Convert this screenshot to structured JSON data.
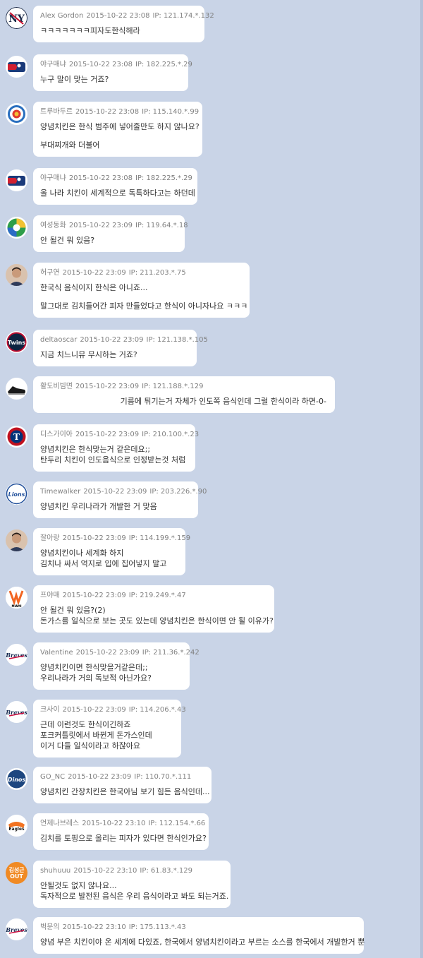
{
  "comments": [
    {
      "nick": "Alex Gordon",
      "time": "2015-10-22 23:08",
      "ip": "IP: 121.174.*.132",
      "lines": [
        "ㅋㅋㅋㅋㅋㅋㅋ피자도한식해라"
      ],
      "avatar_icon": "yankees-logo-icon"
    },
    {
      "nick": "야구매냐",
      "time": "2015-10-22 23:08",
      "ip": "IP: 182.225.*.29",
      "lines": [
        "누구 말이 맞는 거죠?"
      ],
      "avatar_icon": "mlb-logo-icon"
    },
    {
      "nick": "트루바두르",
      "time": "2015-10-22 23:08",
      "ip": "IP: 115.140.*.99",
      "lines": [
        "양념치킨은 한식 범주에 넣어줄만도 하지 않나요?",
        "",
        "부대찌개와 더불어"
      ],
      "avatar_icon": "baseball-classic-logo-icon"
    },
    {
      "nick": "야구매냐",
      "time": "2015-10-22 23:08",
      "ip": "IP: 182.225.*.29",
      "lines": [
        "올 나라 치킨이 세계적으로 독특하다고는 하던데"
      ],
      "avatar_icon": "mlb-logo-icon"
    },
    {
      "nick": "여성동화",
      "time": "2015-10-22 23:09",
      "ip": "IP: 119.64.*.18",
      "lines": [
        "안 될건 뭐 있음?"
      ],
      "avatar_icon": "wbc-logo-icon"
    },
    {
      "nick": "허구연",
      "time": "2015-10-22 23:09",
      "ip": "IP: 211.203.*.75",
      "lines": [
        "한국식 음식이지 한식은 아니죠...",
        "",
        "말그대로 김치들어간 피자 만들었다고 한식이 아니자나요 ㅋㅋㅋ"
      ],
      "avatar_icon": "person-photo-icon"
    },
    {
      "nick": "deltaoscar",
      "time": "2015-10-22 23:09",
      "ip": "IP: 121.138.*.105",
      "lines": [
        "지금 치느니뮤 무시하는 거죠?"
      ],
      "avatar_icon": "twins-logo-icon"
    },
    {
      "nick": "활도비빔면",
      "time": "2015-10-22 23:09",
      "ip": "IP: 121.188.*.129",
      "lines": [
        "기름에 튀기는거 자체가 인도쪽 음식인데 그럴 한식이라 하면-0-"
      ],
      "avatar_icon": "sneaker-icon",
      "align": "right"
    },
    {
      "nick": "디스가이아",
      "time": "2015-10-22 23:09",
      "ip": "IP: 210.100.*.23",
      "lines": [
        "양념치킨은 한식맞는거 같은데요;;",
        "탄두리 치킨이 인도음식으로 인정받는것 처럼"
      ],
      "avatar_icon": "rangers-logo-icon"
    },
    {
      "nick": "Timewalker",
      "time": "2015-10-22 23:09",
      "ip": "IP: 203.226.*.90",
      "lines": [
        "양념치킨 우리나라가 개발한 거 맞음"
      ],
      "avatar_icon": "lions-logo-icon"
    },
    {
      "nick": "잘아랑",
      "time": "2015-10-22 23:09",
      "ip": "IP: 114.199.*.159",
      "lines": [
        "양념치킨이나 세계화 하지",
        "김치나 싸서 억지로 입에 집어넣지 말고"
      ],
      "avatar_icon": "person-photo-icon"
    },
    {
      "nick": "프야매",
      "time": "2015-10-22 23:09",
      "ip": "IP: 219.249.*.47",
      "lines": [
        "안 될건 뭐 있음?(2)",
        "돈가스를 일식으로 보는 곳도 있는데 양념치킨은 한식이면 안 될 이유가?"
      ],
      "avatar_icon": "marlins-logo-icon"
    },
    {
      "nick": "Valentine",
      "time": "2015-10-22 23:09",
      "ip": "IP: 211.36.*.242",
      "lines": [
        "양념치킨이면 한식맞을거같은데;;",
        "우리나라가 거의 독보적 아닌가요?"
      ],
      "avatar_icon": "braves-logo-icon"
    },
    {
      "nick": "크사이",
      "time": "2015-10-22 23:09",
      "ip": "IP: 114.206.*.43",
      "lines": [
        "근데 이런것도 한식이긴하죠",
        "포크커틀릿에서 바뀐게 돈가스인데",
        "이거 다들 일식이라고 하잖아요"
      ],
      "avatar_icon": "braves-logo-icon"
    },
    {
      "nick": "GO_NC",
      "time": "2015-10-22 23:09",
      "ip": "IP: 110.70.*.111",
      "lines": [
        "양념치킨 간장치킨은 한국아님 보기 힘든 음식인데..."
      ],
      "avatar_icon": "dinos-logo-icon"
    },
    {
      "nick": "언제나브레스",
      "time": "2015-10-22 23:10",
      "ip": "IP: 112.154.*.66",
      "lines": [
        "김치를 토핑으로 올리는 피자가 있다면 한식인가요?"
      ],
      "avatar_icon": "eagles-logo-icon"
    },
    {
      "nick": "shuhuuu",
      "time": "2015-10-22 23:10",
      "ip": "IP: 61.83.*.129",
      "lines": [
        "안될것도 없지 않나요...",
        "독자적으로 발전된 음식은 우리 음식이라고 봐도 되는거죠."
      ],
      "avatar_icon": "orange-badge-icon",
      "avatar_text": "김성근 OUT"
    },
    {
      "nick": "벅문의",
      "time": "2015-10-22 23:10",
      "ip": "IP: 175.113.*.43",
      "lines": [
        "양념 부은 치킨이야 온 세계에 다있죠, 한국에서 양념치킨이라고 부르는 소스를 한국에서 개발한거 뿐"
      ],
      "avatar_icon": "braves-logo-icon"
    }
  ],
  "colors": {
    "background": "#c9d4e7",
    "bubble": "#ffffff",
    "meta": "#808080",
    "text": "#333333",
    "badge": "#f08a24"
  }
}
